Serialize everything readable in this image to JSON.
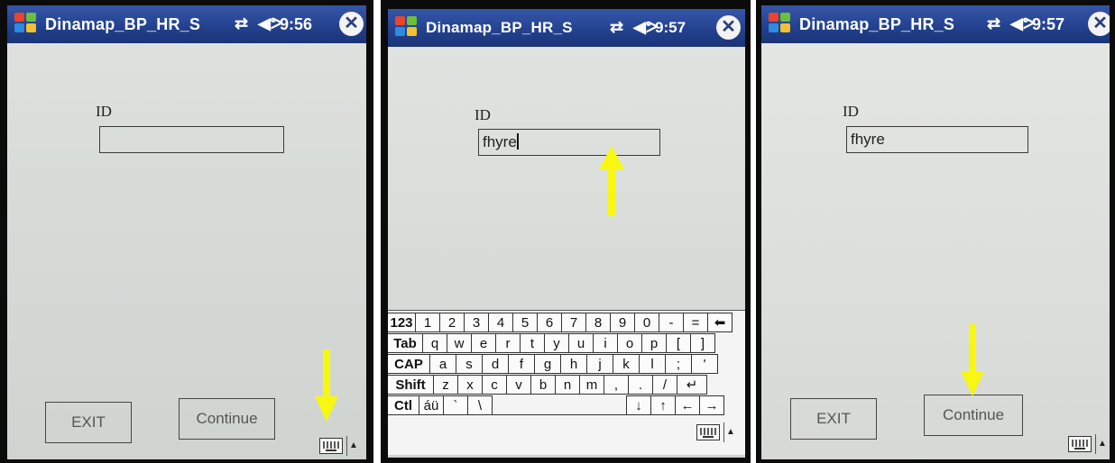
{
  "panels": [
    {
      "title": "Dinamap_BP_HR_S",
      "time": "9:56",
      "id_label": "ID",
      "id_value": "",
      "exit_label": "EXIT",
      "continue_label": "Continue"
    },
    {
      "title": "Dinamap_BP_HR_S",
      "time": "9:57",
      "id_label": "ID",
      "id_value": "fhyre",
      "keyboard": {
        "row1": [
          "123",
          "1",
          "2",
          "3",
          "4",
          "5",
          "6",
          "7",
          "8",
          "9",
          "0",
          "-",
          "=",
          "⬅"
        ],
        "row2": [
          "Tab",
          "q",
          "w",
          "e",
          "r",
          "t",
          "y",
          "u",
          "i",
          "o",
          "p",
          "[",
          "]"
        ],
        "row3": [
          "CAP",
          "a",
          "s",
          "d",
          "f",
          "g",
          "h",
          "j",
          "k",
          "l",
          ";",
          "'"
        ],
        "row4": [
          "Shift",
          "z",
          "x",
          "c",
          "v",
          "b",
          "n",
          "m",
          ",",
          ".",
          "/",
          "↵"
        ],
        "row5": [
          "Ctl",
          "áü",
          "`",
          "\\",
          "",
          "↓",
          "↑",
          "←",
          "→"
        ]
      }
    },
    {
      "title": "Dinamap_BP_HR_S",
      "time": "9:57",
      "id_label": "ID",
      "id_value": "fhyre",
      "exit_label": "EXIT",
      "continue_label": "Continue"
    }
  ],
  "icons": {
    "start": "windows-start-icon",
    "connectivity": "connectivity-icon",
    "volume": "volume-icon",
    "close": "close-icon",
    "keyboard": "keyboard-icon",
    "input_menu": "input-menu-arrow-icon"
  },
  "colors": {
    "titlebar": "#22408c",
    "annotation_arrow": "#f7f712"
  }
}
